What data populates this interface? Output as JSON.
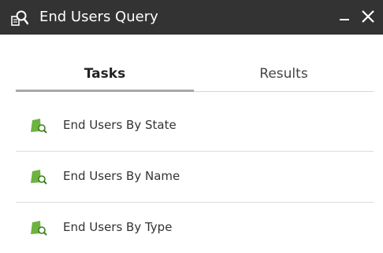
{
  "window": {
    "title": "End Users Query",
    "title_icon": "user-search-icon",
    "minimize_icon": "minimize-icon",
    "close_icon": "close-icon"
  },
  "tabs": [
    {
      "label": "Tasks",
      "active": true
    },
    {
      "label": "Results",
      "active": false
    }
  ],
  "tasks": [
    {
      "label": "End Users By State",
      "icon": "query-search-icon"
    },
    {
      "label": "End Users By Name",
      "icon": "query-search-icon"
    },
    {
      "label": "End Users By Type",
      "icon": "query-search-icon"
    }
  ],
  "colors": {
    "titlebar_bg": "#333333",
    "icon_green": "#6cb33f",
    "tab_underline": "#a8a8a8"
  }
}
